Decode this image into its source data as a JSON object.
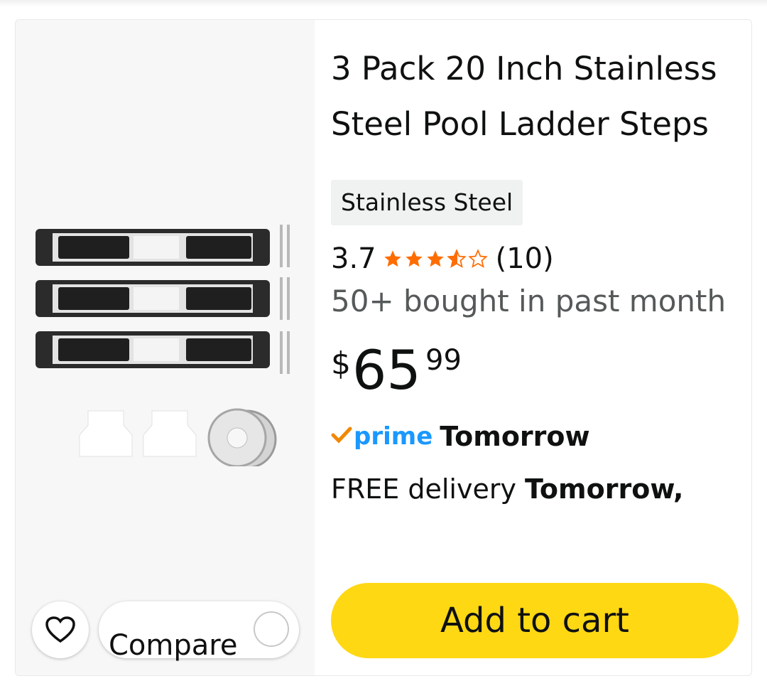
{
  "product": {
    "title": "3 Pack 20 Inch Stainless Steel Pool Ladder Steps",
    "variant": "Stainless Steel",
    "rating": "3.7",
    "rating_value": 3.7,
    "rating_count": "(10)",
    "bought": "50+ bought in past month",
    "price": {
      "symbol": "$",
      "whole": "65",
      "fraction": "99"
    },
    "prime_label": "prime",
    "prime_delivery": "Tomorrow",
    "free_delivery_prefix": "FREE delivery ",
    "free_delivery_date": "Tomorrow,"
  },
  "actions": {
    "compare_label": "Compare",
    "add_to_cart": "Add to cart"
  },
  "icons": {
    "wishlist": "heart-icon",
    "star": "star-icon",
    "prime_check": "prime-check-icon"
  },
  "colors": {
    "cart_button": "#ffd814",
    "star": "#ff6d00",
    "prime": "#1a98ff",
    "prime_check": "#f08804",
    "secondary_text": "#565959"
  }
}
